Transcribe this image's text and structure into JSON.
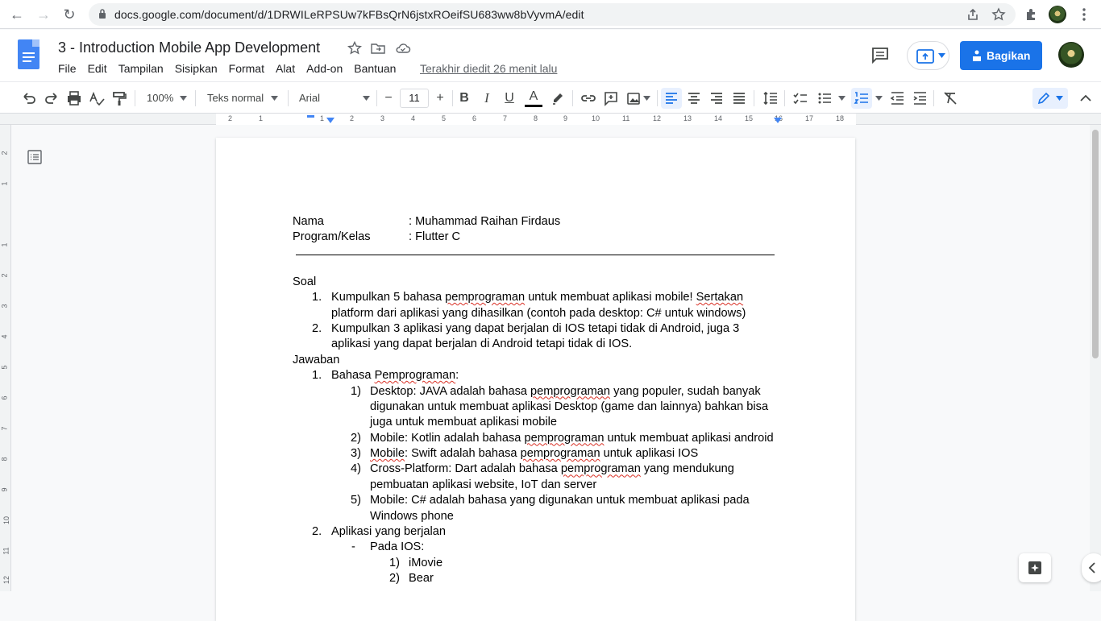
{
  "browser": {
    "url": "docs.google.com/document/d/1DRWILeRPSUw7kFBsQrN6jstxROeifSU683ww8bVyvmA/edit",
    "back_icon": "←",
    "forward_icon": "→",
    "reload_icon": "↻"
  },
  "header": {
    "title": "3 - Introduction Mobile App Development",
    "menu": [
      "File",
      "Edit",
      "Tampilan",
      "Sisipkan",
      "Format",
      "Alat",
      "Add-on",
      "Bantuan"
    ],
    "last_edit": "Terakhir diedit 26 menit lalu",
    "share_label": "Bagikan",
    "accent_color": "#1a73e8"
  },
  "toolbar": {
    "zoom": "100%",
    "style": "Teks normal",
    "font": "Arial",
    "font_size": "11",
    "minus": "−",
    "plus": "+",
    "bold": "B",
    "italic": "I",
    "underline": "U",
    "text_color": "A"
  },
  "ruler": {
    "numbers": [
      "2",
      "1",
      "1",
      "2",
      "3",
      "4",
      "5",
      "6",
      "7",
      "8",
      "9",
      "10",
      "11",
      "12",
      "13",
      "14",
      "15",
      "16",
      "17",
      "18"
    ],
    "vertical_numbers": [
      "2",
      "1",
      "1",
      "2",
      "3",
      "4",
      "5",
      "6",
      "7",
      "8",
      "9",
      "10",
      "11",
      "12"
    ]
  },
  "doc": {
    "info": [
      {
        "label": "Nama",
        "value": ": Muhammad Raihan Firdaus"
      },
      {
        "label": "Program/Kelas",
        "value": ": Flutter C"
      }
    ],
    "soal_heading": "Soal",
    "soal": [
      {
        "num": "1.",
        "lines": [
          "Kumpulkan 5 bahasa pemprograman untuk membuat aplikasi mobile! Sertakan",
          "platform dari aplikasi yang dihasilkan (contoh pada desktop: C# untuk windows)"
        ]
      },
      {
        "num": "2.",
        "lines": [
          "Kumpulkan 3 aplikasi yang dapat berjalan di IOS tetapi tidak di Android, juga 3",
          "aplikasi yang dapat berjalan di Android tetapi tidak di IOS."
        ]
      }
    ],
    "jawaban_heading": "Jawaban",
    "jawaban1_num": "1.",
    "jawaban1_title": "Bahasa Pemprograman:",
    "bahasa": [
      {
        "num": "1)",
        "lines": [
          "Desktop: JAVA adalah bahasa pemprograman yang populer, sudah banyak",
          "digunakan untuk membuat aplikasi Desktop (game dan lainnya) bahkan bisa",
          "juga untuk membuat aplikasi mobile"
        ]
      },
      {
        "num": "2)",
        "lines": [
          "Mobile: Kotlin adalah bahasa pemprograman untuk membuat aplikasi android"
        ]
      },
      {
        "num": "3)",
        "lines": [
          "Mobile: Swift adalah bahasa pemprograman untuk aplikasi IOS"
        ]
      },
      {
        "num": "4)",
        "lines": [
          "Cross-Platform: Dart adalah bahasa pemprograman yang mendukung",
          "pembuatan aplikasi website, IoT dan server"
        ]
      },
      {
        "num": "5)",
        "lines": [
          "Mobile: C# adalah bahasa yang digunakan untuk membuat aplikasi pada",
          "Windows phone"
        ]
      }
    ],
    "jawaban2_num": "2.",
    "jawaban2_title": "Aplikasi yang berjalan",
    "ios_bullet": "-",
    "ios_title": "Pada IOS:",
    "ios_apps": [
      {
        "num": "1)",
        "name": "iMovie"
      },
      {
        "num": "2)",
        "name": "Bear"
      }
    ]
  }
}
